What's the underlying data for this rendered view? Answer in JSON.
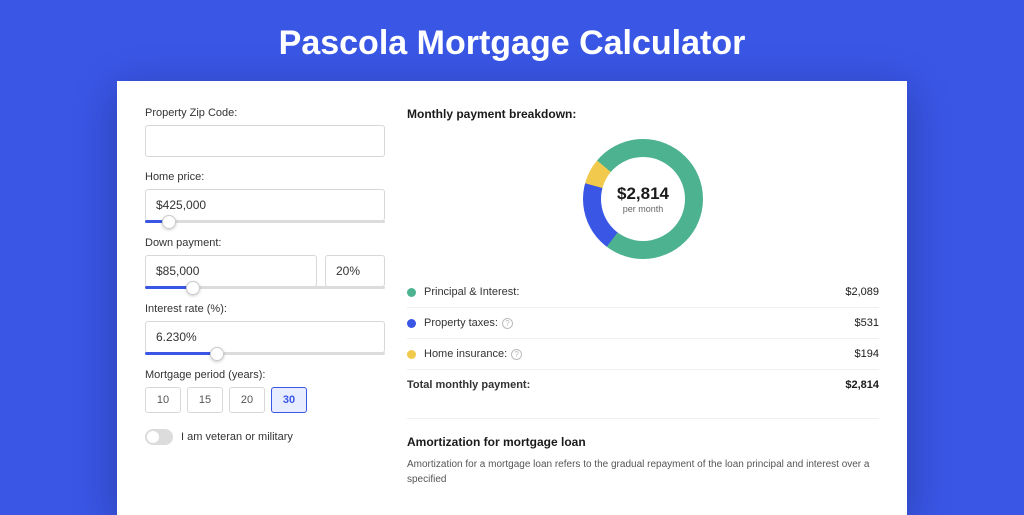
{
  "title": "Pascola Mortgage Calculator",
  "form": {
    "zip": {
      "label": "Property Zip Code:",
      "value": ""
    },
    "home_price": {
      "label": "Home price:",
      "value": "$425,000",
      "slider_pct": 10
    },
    "down_payment": {
      "label": "Down payment:",
      "amount": "$85,000",
      "percent": "20%",
      "slider_pct": 20
    },
    "interest": {
      "label": "Interest rate (%):",
      "value": "6.230%",
      "slider_pct": 30
    },
    "period": {
      "label": "Mortgage period (years):",
      "options": [
        "10",
        "15",
        "20",
        "30"
      ],
      "selected": "30"
    },
    "veteran": {
      "label": "I am veteran or military",
      "checked": false
    }
  },
  "breakdown": {
    "heading": "Monthly payment breakdown:",
    "donut": {
      "amount": "$2,814",
      "sub": "per month"
    },
    "rows": [
      {
        "color": "green",
        "label": "Principal & Interest:",
        "value": "$2,089",
        "info": false
      },
      {
        "color": "blue",
        "label": "Property taxes:",
        "value": "$531",
        "info": true
      },
      {
        "color": "yellow",
        "label": "Home insurance:",
        "value": "$194",
        "info": true
      }
    ],
    "total": {
      "label": "Total monthly payment:",
      "value": "$2,814"
    }
  },
  "amort": {
    "title": "Amortization for mortgage loan",
    "text": "Amortization for a mortgage loan refers to the gradual repayment of the loan principal and interest over a specified"
  },
  "chart_data": {
    "type": "pie",
    "title": "Monthly payment breakdown",
    "series": [
      {
        "name": "Principal & Interest",
        "value": 2089,
        "color": "#4cb28f"
      },
      {
        "name": "Property taxes",
        "value": 531,
        "color": "#3956e5"
      },
      {
        "name": "Home insurance",
        "value": 194,
        "color": "#f1c94d"
      }
    ],
    "total": 2814,
    "center_label": "$2,814 per month"
  }
}
